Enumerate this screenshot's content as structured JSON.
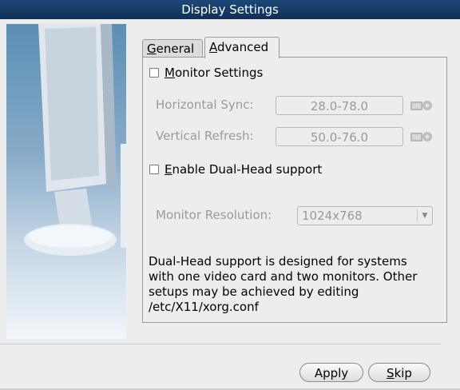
{
  "window": {
    "title": "Display Settings"
  },
  "tabs": [
    {
      "label": "General",
      "mnemonic": "G",
      "rest": "eneral",
      "selected": false
    },
    {
      "label": "Advanced",
      "mnemonic": "A",
      "rest": "dvanced",
      "selected": true
    }
  ],
  "monitor": {
    "checkbox_mn": "M",
    "checkbox_rest": "onitor Settings",
    "checked": false,
    "hsync_label": "Horizontal Sync:",
    "hsync_value": "28.0-78.0",
    "vrefresh_label": "Vertical Refresh:",
    "vrefresh_value": "50.0-76.0",
    "probe_icon": "probe-icon"
  },
  "dualhead": {
    "checkbox_mn": "E",
    "checkbox_rest": "nable Dual-Head support",
    "checked": false,
    "resolution_label": "Monitor Resolution:",
    "resolution_value": "1024x768",
    "description_lines": [
      "Dual-Head support is designed for systems",
      "with one video card and two monitors. Other",
      "setups may be achieved by editing",
      "/etc/X11/xorg.conf"
    ]
  },
  "buttons": {
    "apply": "Apply",
    "skip_mn": "S",
    "skip_rest": "kip"
  },
  "colors": {
    "titlebar": "#1c4878",
    "background": "#ededed",
    "disabled_text": "#9a9a9a"
  }
}
